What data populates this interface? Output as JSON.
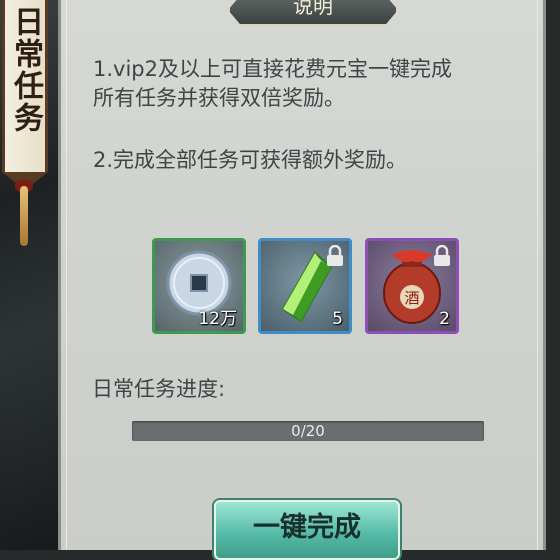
{
  "banner": {
    "title": "日常任务"
  },
  "panel": {
    "title": "说明",
    "desc_lines": [
      "1.vip2及以上可直接花费元宝一键完成",
      "所有任务并获得双倍奖励。",
      "2.完成全部任务可获得额外奖励。"
    ]
  },
  "rewards": [
    {
      "icon": "copper-coin-icon",
      "count": "12万",
      "locked": false,
      "rarity_color": "#3d9b4f"
    },
    {
      "icon": "green-crystal-icon",
      "count": "5",
      "locked": true,
      "rarity_color": "#3f8cc6"
    },
    {
      "icon": "wine-jar-icon",
      "count": "2",
      "locked": true,
      "rarity_color": "#8d4fb5"
    }
  ],
  "progress": {
    "label": "日常任务进度:",
    "text": "0/20",
    "fraction": 0
  },
  "complete_button": {
    "label": "一键完成"
  },
  "jar_label": "酒"
}
